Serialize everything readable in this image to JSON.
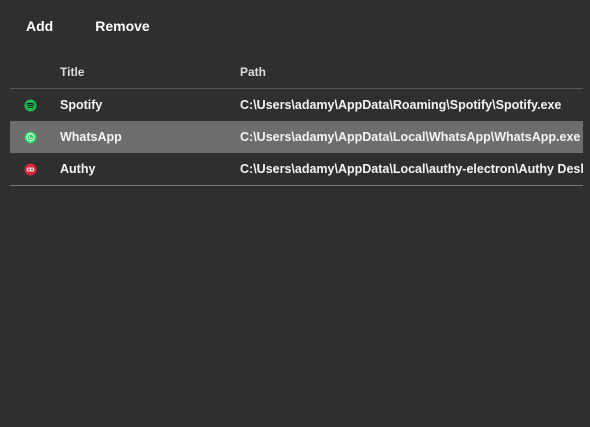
{
  "toolbar": {
    "add_label": "Add",
    "remove_label": "Remove"
  },
  "table": {
    "columns": {
      "title": "Title",
      "path": "Path"
    },
    "rows": [
      {
        "icon": "spotify-icon",
        "title": "Spotify",
        "path": "C:\\Users\\adamy\\AppData\\Roaming\\Spotify\\Spotify.exe",
        "selected": false
      },
      {
        "icon": "whatsapp-icon",
        "title": "WhatsApp",
        "path": "C:\\Users\\adamy\\AppData\\Local\\WhatsApp\\WhatsApp.exe",
        "selected": true
      },
      {
        "icon": "authy-icon",
        "title": "Authy",
        "path": "C:\\Users\\adamy\\AppData\\Local\\authy-electron\\Authy Desktop.exe",
        "selected": false
      }
    ]
  },
  "colors": {
    "background": "#2f2f2f",
    "selected_row": "#6d6d6d",
    "spotify": "#1db954",
    "whatsapp": "#25d366",
    "authy": "#d9263b"
  }
}
